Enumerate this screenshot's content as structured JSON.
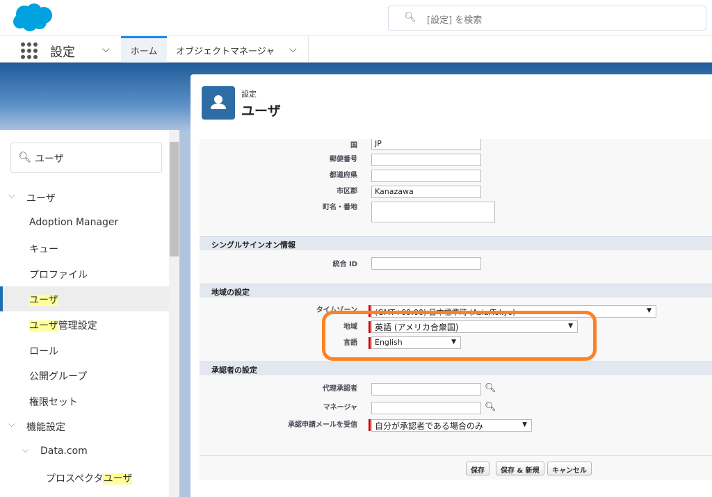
{
  "header": {
    "search_placeholder": "[設定] を検索"
  },
  "nav": {
    "app_title": "設定",
    "tabs": [
      {
        "label": "ホーム",
        "selected": true
      },
      {
        "label": "オブジェクトマネージャ"
      }
    ]
  },
  "sidebar": {
    "search_value": "ユーザ",
    "items": [
      {
        "pre": "",
        "hl": "",
        "post": "ユーザ",
        "type": "group"
      },
      {
        "pre": "",
        "hl": "",
        "post": "Adoption Manager"
      },
      {
        "pre": "",
        "hl": "",
        "post": "キュー"
      },
      {
        "pre": "",
        "hl": "",
        "post": "プロファイル"
      },
      {
        "pre": "",
        "hl": "ユーザ",
        "post": "",
        "selected": true
      },
      {
        "pre": "",
        "hl": "ユーザ",
        "post": "管理設定"
      },
      {
        "pre": "",
        "hl": "",
        "post": "ロール"
      },
      {
        "pre": "",
        "hl": "",
        "post": "公開グループ"
      },
      {
        "pre": "",
        "hl": "",
        "post": "権限セット"
      },
      {
        "pre": "",
        "hl": "",
        "post": "機能設定",
        "type": "group"
      },
      {
        "pre": "",
        "hl": "",
        "post": "Data.com",
        "type": "subgroup"
      },
      {
        "pre": "プロスペクタ",
        "hl": "ユーザ",
        "post": ""
      }
    ]
  },
  "page": {
    "breadcrumb": "設定",
    "title": "ユーザ"
  },
  "form": {
    "address": {
      "country_label": "国",
      "country_value": "JP",
      "postal_label": "郵便番号",
      "postal_value": "",
      "state_label": "都道府県",
      "state_value": "",
      "city_label": "市区郡",
      "city_value": "Kanazawa",
      "street_label": "町名・番地",
      "street_value": ""
    },
    "sso": {
      "title": "シングルサインオン情報",
      "federation_label": "統合 ID",
      "federation_value": ""
    },
    "locale": {
      "title": "地域の設定",
      "timezone_label": "タイムゾーン",
      "timezone_value": "(GMT+09:00) 日本標準時 (Asia/Tokyo)",
      "locale_label": "地域",
      "locale_value": "英語 (アメリカ合衆国)",
      "language_label": "言語",
      "language_value": "English"
    },
    "approver": {
      "title": "承認者の設定",
      "delegate_label": "代理承認者",
      "delegate_value": "",
      "manager_label": "マネージャ",
      "manager_value": "",
      "email_label": "承認申請メールを受信",
      "email_value": "自分が承認者である場合のみ"
    },
    "buttons": {
      "save": "保存",
      "save_new": "保存 & 新規",
      "cancel": "キャンセル"
    }
  },
  "colors": {
    "brand": "#00a1e0",
    "highlight_box": "#ff8125",
    "required": "#cc0000"
  }
}
